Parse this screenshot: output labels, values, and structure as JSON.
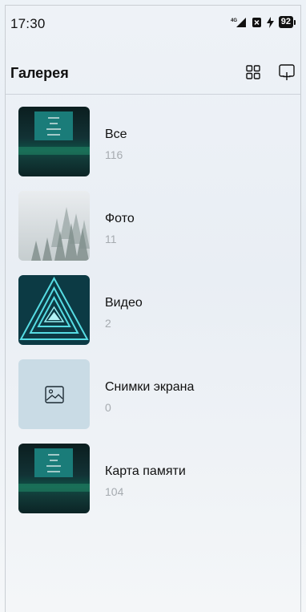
{
  "status_bar": {
    "time": "17:30",
    "network": "4G",
    "battery": "92"
  },
  "header": {
    "title": "Галерея"
  },
  "albums": [
    {
      "name": "Все",
      "count": "116",
      "thumb": "screen"
    },
    {
      "name": "Фото",
      "count": "11",
      "thumb": "forest"
    },
    {
      "name": "Видео",
      "count": "2",
      "thumb": "neon"
    },
    {
      "name": "Снимки экрана",
      "count": "0",
      "thumb": "placeholder"
    },
    {
      "name": "Карта памяти",
      "count": "104",
      "thumb": "screen"
    }
  ]
}
